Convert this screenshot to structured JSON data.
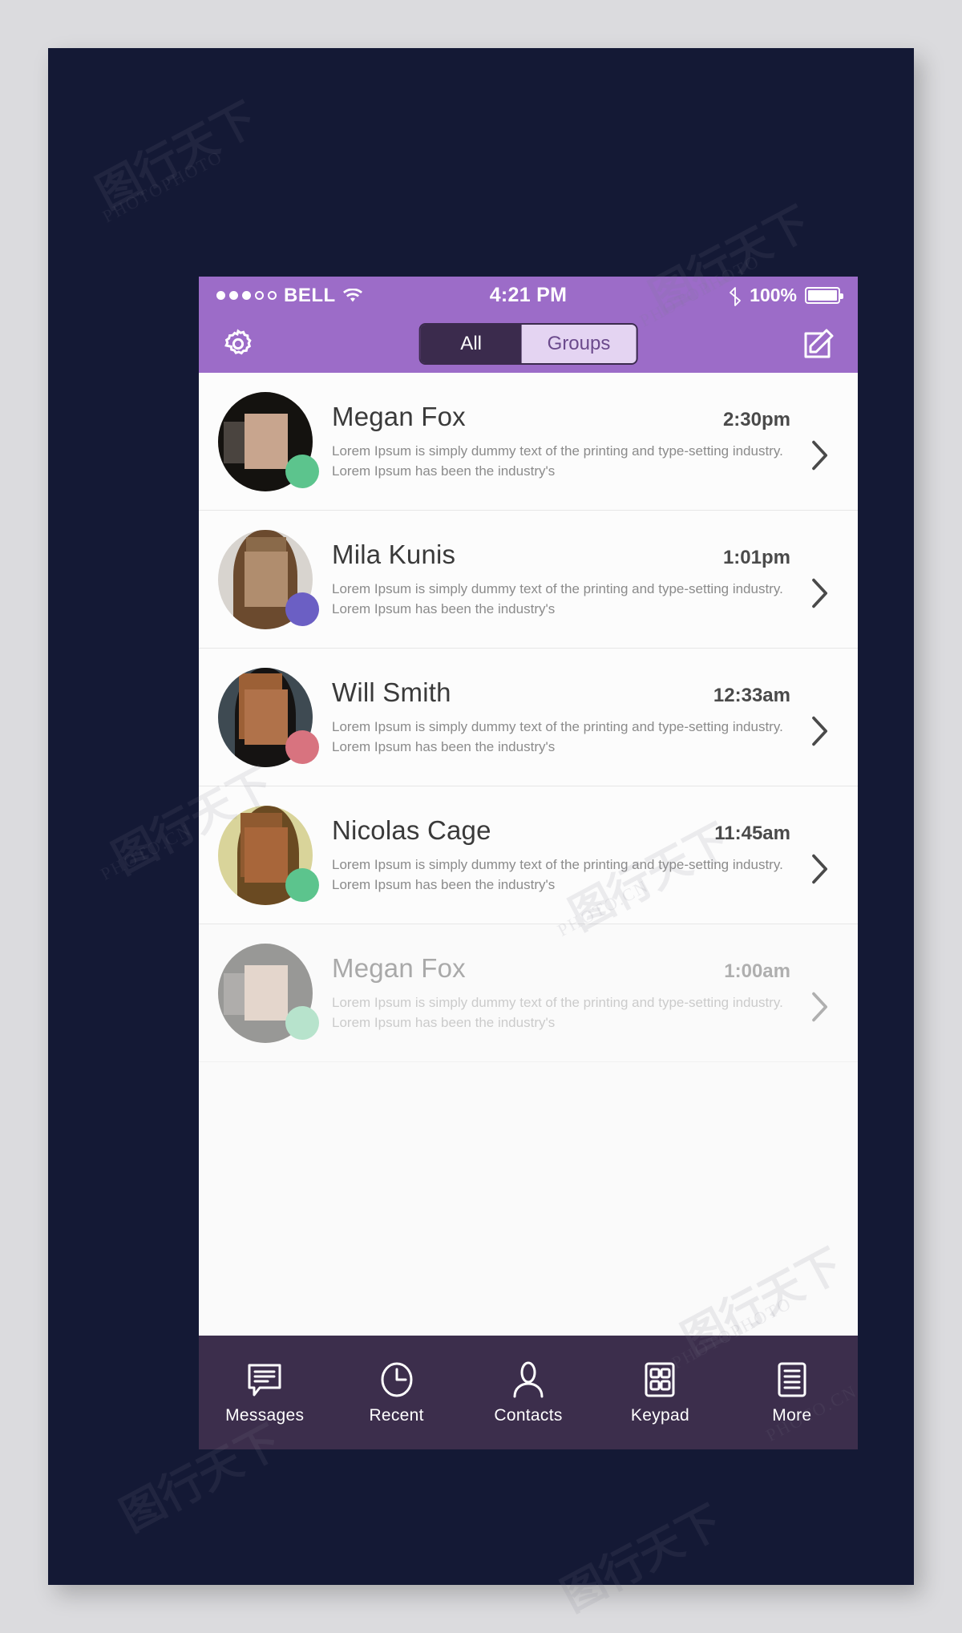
{
  "theme": {
    "page_background": "#dbdbde",
    "board_background": "#141935",
    "accent_purple": "#9c6cc8",
    "tabbar_background": "#3c2e4c",
    "segment_active_background": "#3b2b4d",
    "segment_inactive_background": "#e4d4f2"
  },
  "status_bar": {
    "signal_dots_filled": 3,
    "signal_dots_total": 5,
    "carrier": "BELL",
    "wifi_icon": "wifi-icon",
    "time": "4:21 PM",
    "bluetooth_icon": "bluetooth-icon",
    "battery_percent": "100%",
    "battery_icon": "battery-full-icon"
  },
  "nav_bar": {
    "settings_icon": "gear-icon",
    "compose_icon": "compose-pencil-icon",
    "segments": [
      {
        "label": "All",
        "active": true
      },
      {
        "label": "Groups",
        "active": false
      }
    ]
  },
  "conversations": [
    {
      "name": "Megan Fox",
      "time": "2:30pm",
      "preview": "Lorem Ipsum is simply dummy text of the printing and type-setting industry. Lorem Ipsum has been the industry's",
      "presence_color": "#5cc48d",
      "muted": false,
      "avatar": {
        "hair": "#14120f",
        "face": "#c8a58e",
        "block": "#4a443f",
        "bg": "#efe7df"
      }
    },
    {
      "name": "Mila Kunis",
      "time": "1:01pm",
      "preview": "Lorem Ipsum is simply dummy text of the printing and type-setting industry. Lorem Ipsum has been the industry's",
      "presence_color": "#6b5fc4",
      "muted": false,
      "avatar": {
        "hair": "#6b4a2e",
        "face": "#b08d6e",
        "block": "#8a6a4a",
        "bg": "#d8d4cf"
      }
    },
    {
      "name": "Will Smith",
      "time": "12:33am",
      "preview": "Lorem Ipsum is simply dummy text of the printing and type-setting industry. Lorem Ipsum has been the industry's",
      "presence_color": "#d8737f",
      "muted": false,
      "avatar": {
        "hair": "#151312",
        "face": "#b0724a",
        "block": "#9c6036",
        "bg": "#3e4a52"
      }
    },
    {
      "name": "Nicolas Cage",
      "time": "11:45am",
      "preview": "Lorem Ipsum is simply dummy text of the printing and type-setting industry. Lorem Ipsum has been the industry's",
      "presence_color": "#5cc48d",
      "muted": false,
      "avatar": {
        "hair": "#6a4a22",
        "face": "#a8663a",
        "block": "#8f5a30",
        "bg": "#d9d49a"
      }
    },
    {
      "name": "Megan Fox",
      "time": "1:00am",
      "preview": "Lorem Ipsum is simply dummy text of the printing and type-setting industry. Lorem Ipsum has been the industry's",
      "presence_color": "#5cc48d",
      "muted": true,
      "avatar": {
        "hair": "#14120f",
        "face": "#c8a58e",
        "block": "#4a443f",
        "bg": "#efe7df"
      }
    }
  ],
  "tab_bar": {
    "tabs": [
      {
        "label": "Messages",
        "icon": "messages-bubble-icon"
      },
      {
        "label": "Recent",
        "icon": "clock-icon"
      },
      {
        "label": "Contacts",
        "icon": "person-icon"
      },
      {
        "label": "Keypad",
        "icon": "grid-keypad-icon"
      },
      {
        "label": "More",
        "icon": "list-more-icon"
      }
    ]
  },
  "watermarks": {
    "text_a": "PHOTOPHOTO",
    "text_b": "PHOTO.CN",
    "text_c": "图行天下"
  }
}
